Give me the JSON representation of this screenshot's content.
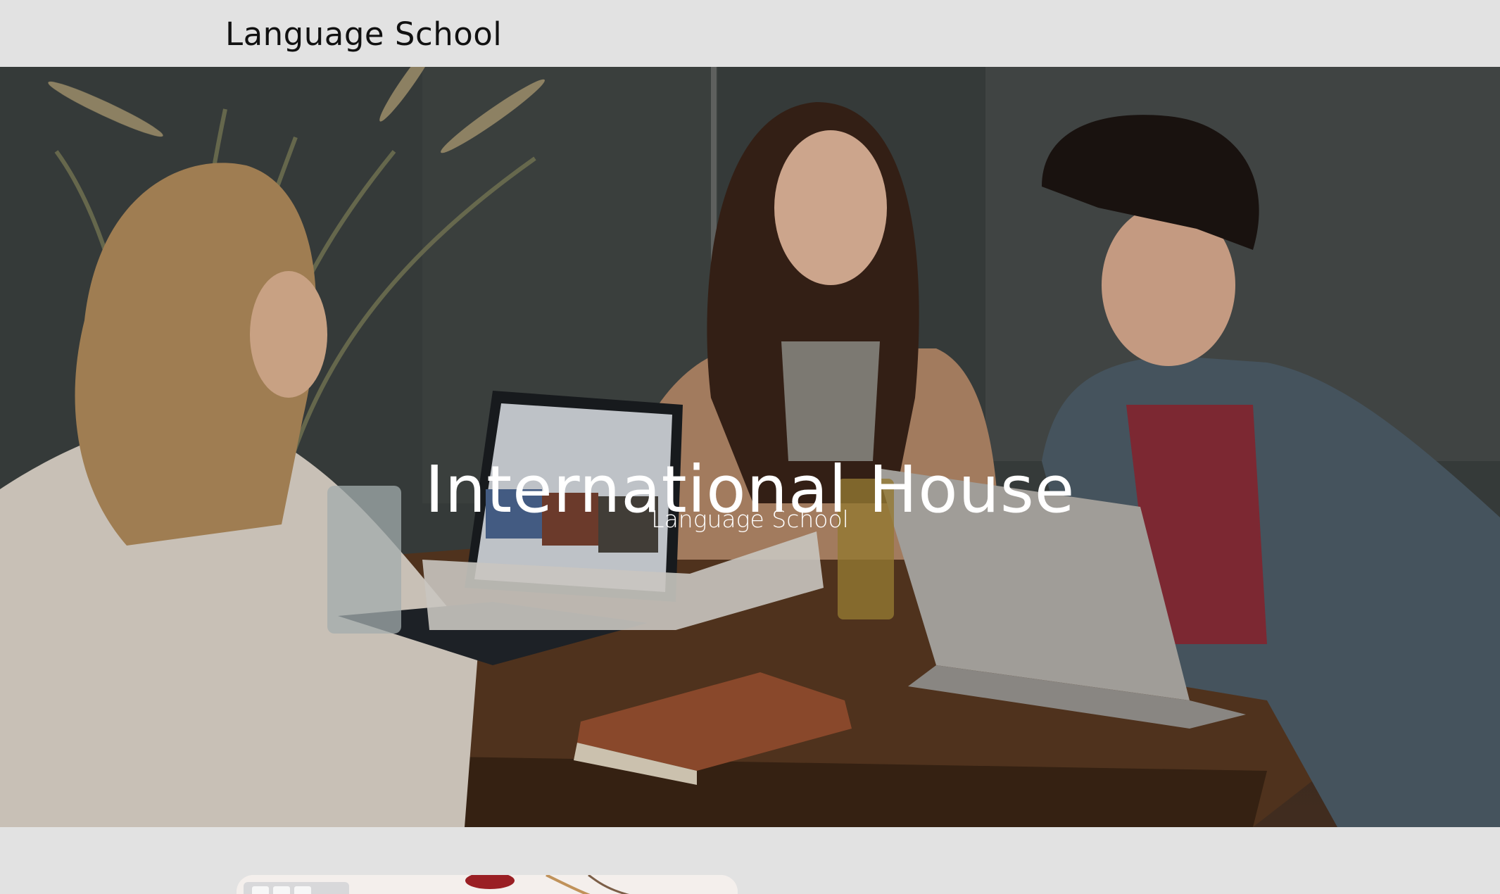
{
  "header": {
    "brand": "Language School"
  },
  "hero": {
    "title": "International House",
    "subtitle": "Language School",
    "image": "students-laughing-at-table-with-laptops"
  },
  "next_section": {
    "image": "desk-with-keyboard-and-glasses"
  },
  "colors": {
    "page_background": "#e2e2e2",
    "hero_text": "#ffffff",
    "brand_text": "#111111"
  }
}
